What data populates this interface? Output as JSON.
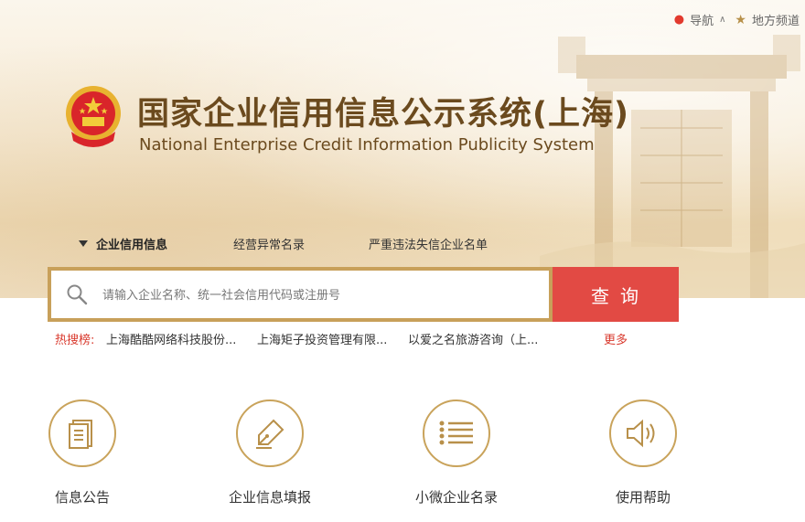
{
  "topnav": {
    "nav_label": "导航",
    "nav_caret": "∧",
    "local_label": "地方频道"
  },
  "brand": {
    "title_cn": "国家企业信用信息公示系统(上海)",
    "title_en": "National Enterprise Credit Information Publicity System"
  },
  "tabs": [
    {
      "label": "企业信用信息",
      "active": true
    },
    {
      "label": "经营异常名录",
      "active": false
    },
    {
      "label": "严重违法失信企业名单",
      "active": false
    }
  ],
  "search": {
    "placeholder": "请输入企业名称、统一社会信用代码或注册号",
    "value": "",
    "button_label": "查询"
  },
  "hot": {
    "label": "热搜榜:",
    "items": [
      "上海酷酷网络科技股份...",
      "上海矩子投资管理有限...",
      "以爱之名旅游咨询（上..."
    ],
    "more_label": "更多"
  },
  "services": [
    {
      "label": "信息公告",
      "icon": "document-icon"
    },
    {
      "label": "企业信息填报",
      "icon": "pen-icon"
    },
    {
      "label": "小微企业名录",
      "icon": "list-icon"
    },
    {
      "label": "使用帮助",
      "icon": "speaker-icon"
    }
  ],
  "colors": {
    "gold": "#c8a05a",
    "brown": "#6b4a1e",
    "red": "#e24a44",
    "hot_red": "#d93a2e"
  }
}
